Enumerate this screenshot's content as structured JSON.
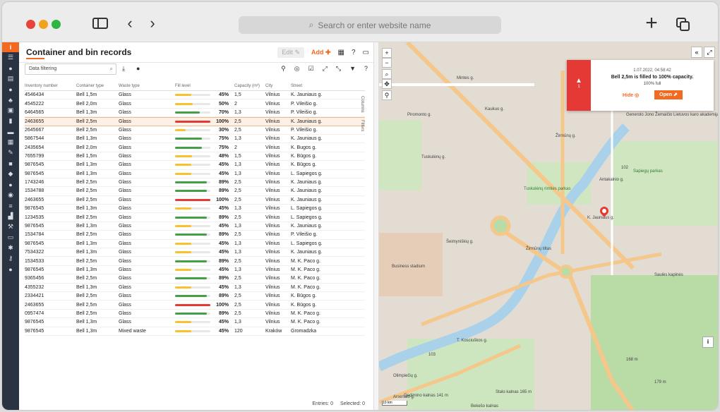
{
  "browser": {
    "url_placeholder": "Search or enter website name"
  },
  "app": {
    "title": "Container and bin records",
    "edit_label": "Edit",
    "add_label": "Add",
    "filter_placeholder": "Data filtering",
    "side_tabs": [
      "Columns",
      "Filters"
    ],
    "columns": [
      "Inventory number",
      "Container type",
      "Waste type",
      "Fill level",
      "Capacity (m³)",
      "City",
      "Street"
    ],
    "rows": [
      {
        "inv": "4546434",
        "type": "Bell 1,5m",
        "waste": "Glass",
        "fill": 45,
        "cap": "1,5",
        "city": "Vilnius",
        "street": "K. Jauniaus g."
      },
      {
        "inv": "4545222",
        "type": "Bell 2,0m",
        "waste": "Glass",
        "fill": 50,
        "cap": "2",
        "city": "Vilnius",
        "street": "P. Vileišio g."
      },
      {
        "inv": "6464565",
        "type": "Bell 1,3m",
        "waste": "Glass",
        "fill": 70,
        "cap": "1,3",
        "city": "Vilnius",
        "street": "P. Vileišio g."
      },
      {
        "inv": "2463655",
        "type": "Bell 2,5m",
        "waste": "Glass",
        "fill": 100,
        "cap": "2,5",
        "city": "Vilnius",
        "street": "K. Jauniaus g."
      },
      {
        "inv": "2645667",
        "type": "Bell 2,5m",
        "waste": "Glass",
        "fill": 30,
        "cap": "2,5",
        "city": "Vilnius",
        "street": "P. Vileišio g."
      },
      {
        "inv": "5867544",
        "type": "Bell 1,3m",
        "waste": "Glass",
        "fill": 75,
        "cap": "1,3",
        "city": "Vilnius",
        "street": "K. Jauniaus g."
      },
      {
        "inv": "2435654",
        "type": "Bell 2,0m",
        "waste": "Glass",
        "fill": 75,
        "cap": "2",
        "city": "Vilnius",
        "street": "K. Bugos g."
      },
      {
        "inv": "7655799",
        "type": "Bell 1,5m",
        "waste": "Glass",
        "fill": 48,
        "cap": "1,5",
        "city": "Vilnius",
        "street": "K. Būgos g."
      },
      {
        "inv": "9876545",
        "type": "Bell 1,3m",
        "waste": "Glass",
        "fill": 45,
        "cap": "1,3",
        "city": "Vilnius",
        "street": "K. Būgos g."
      },
      {
        "inv": "9876545",
        "type": "Bell 1,3m",
        "waste": "Glass",
        "fill": 45,
        "cap": "1,3",
        "city": "Vilnius",
        "street": "L. Sapiegos g."
      },
      {
        "inv": "1743246",
        "type": "Bell 2,5m",
        "waste": "Glass",
        "fill": 89,
        "cap": "2,5",
        "city": "Vilnius",
        "street": "K. Jauniaus g."
      },
      {
        "inv": "1534788",
        "type": "Bell 2,5m",
        "waste": "Glass",
        "fill": 89,
        "cap": "2,5",
        "city": "Vilnius",
        "street": "K. Jauniaus g."
      },
      {
        "inv": "2463655",
        "type": "Bell 2,5m",
        "waste": "Glass",
        "fill": 100,
        "cap": "2,5",
        "city": "Vilnius",
        "street": "K. Jauniaus g."
      },
      {
        "inv": "9876545",
        "type": "Bell 1,3m",
        "waste": "Glass",
        "fill": 45,
        "cap": "1,3",
        "city": "Vilnius",
        "street": "L. Sapiegos g."
      },
      {
        "inv": "1234535",
        "type": "Bell 2,5m",
        "waste": "Glass",
        "fill": 89,
        "cap": "2,5",
        "city": "Vilnius",
        "street": "L. Sapiegos g."
      },
      {
        "inv": "9876545",
        "type": "Bell 1,3m",
        "waste": "Glass",
        "fill": 45,
        "cap": "1,3",
        "city": "Vilnius",
        "street": "K. Jauniaus g."
      },
      {
        "inv": "1534784",
        "type": "Bell 2,5m",
        "waste": "Glass",
        "fill": 89,
        "cap": "2,5",
        "city": "Vilnius",
        "street": "P. Vileišio g."
      },
      {
        "inv": "9876545",
        "type": "Bell 1,3m",
        "waste": "Glass",
        "fill": 45,
        "cap": "1,3",
        "city": "Vilnius",
        "street": "L. Sapiegos g."
      },
      {
        "inv": "7534322",
        "type": "Bell 1,3m",
        "waste": "Glass",
        "fill": 45,
        "cap": "1,3",
        "city": "Vilnius",
        "street": "K. Jauniaus g."
      },
      {
        "inv": "1534533",
        "type": "Bell 2,5m",
        "waste": "Glass",
        "fill": 89,
        "cap": "2,5",
        "city": "Vilnius",
        "street": "M. K. Paco g."
      },
      {
        "inv": "9876545",
        "type": "Bell 1,3m",
        "waste": "Glass",
        "fill": 45,
        "cap": "1,3",
        "city": "Vilnius",
        "street": "M. K. Paco g."
      },
      {
        "inv": "9365456",
        "type": "Bell 2,5m",
        "waste": "Glass",
        "fill": 89,
        "cap": "2,5",
        "city": "Vilnius",
        "street": "M. K. Paco g."
      },
      {
        "inv": "4355232",
        "type": "Bell 1,3m",
        "waste": "Glass",
        "fill": 45,
        "cap": "1,3",
        "city": "Vilnius",
        "street": "M. K. Paco g."
      },
      {
        "inv": "2334421",
        "type": "Bell 2,5m",
        "waste": "Glass",
        "fill": 89,
        "cap": "2,5",
        "city": "Vilnius",
        "street": "K. Būgos g."
      },
      {
        "inv": "2463655",
        "type": "Bell 2,5m",
        "waste": "Glass",
        "fill": 100,
        "cap": "2,5",
        "city": "Vilnius",
        "street": "K. Būgos g."
      },
      {
        "inv": "0957474",
        "type": "Bell 2,5m",
        "waste": "Glass",
        "fill": 89,
        "cap": "2,5",
        "city": "Vilnius",
        "street": "M. K. Paco g."
      },
      {
        "inv": "9876545",
        "type": "Bell 1,3m",
        "waste": "Glass",
        "fill": 45,
        "cap": "1,3",
        "city": "Vilnius",
        "street": "M. K. Paco g."
      },
      {
        "inv": "9876545",
        "type": "Bell 1,3m",
        "waste": "Mixed waste",
        "fill": 45,
        "cap": "120",
        "city": "Kraków",
        "street": "Gromadzka"
      }
    ],
    "highlighted_row": 3,
    "footer": {
      "entries": "Entries: 0",
      "selected": "Selected: 0"
    },
    "colors": {
      "accent": "#f26a22",
      "red": "#e53935",
      "green": "#43a047",
      "yellow": "#fbc02d"
    }
  },
  "map": {
    "labels": [
      {
        "t": "Mintes g."
      },
      {
        "t": "Piromonto g."
      },
      {
        "t": "Kaukuo g."
      },
      {
        "t": "Tuskulėnų g."
      },
      {
        "t": "Žirmūnų g."
      },
      {
        "t": "Tuskulėnų rimties parkas",
        "g": true
      },
      {
        "t": "Sapiegų parkas",
        "g": true
      },
      {
        "t": "Generolo Jono Žemaičio Lietuvos karo akademija"
      },
      {
        "t": "K. Jauniaus g."
      },
      {
        "t": "Šeimyniškių g."
      },
      {
        "t": "Žirmūnų tiltas"
      },
      {
        "t": "Antakalnio g."
      },
      {
        "t": "Business stadium"
      },
      {
        "t": "Olimpiečių g."
      },
      {
        "t": "Arsenalo g."
      },
      {
        "t": "T. Kosciuškos g."
      },
      {
        "t": "Gedimino kalnas 141 m"
      },
      {
        "t": "Stalo kalnas 165 m"
      },
      {
        "t": "Bekešo kalnas"
      },
      {
        "t": "Saulės kapinės"
      },
      {
        "t": "179 m"
      },
      {
        "t": "168 m"
      },
      {
        "t": "102"
      },
      {
        "t": "103"
      }
    ],
    "scale": "10 km"
  },
  "alert": {
    "count": "1",
    "time": "1.07.2022, 04:58:42",
    "message": "Bell 2,5m is filled to 100% capacity.",
    "sub": "100% full",
    "hide_label": "Hide",
    "open_label": "Open"
  }
}
